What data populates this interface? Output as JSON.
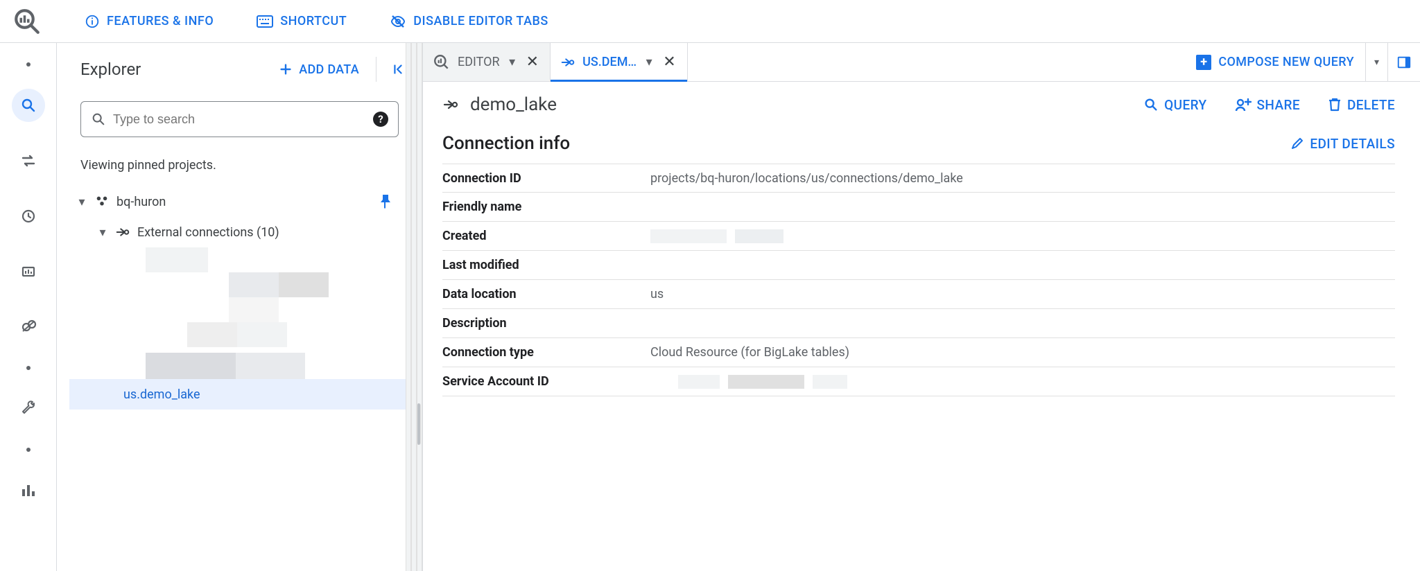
{
  "topbar": {
    "features_info": "FEATURES & INFO",
    "shortcut": "SHORTCUT",
    "disable_tabs": "DISABLE EDITOR TABS"
  },
  "explorer": {
    "title": "Explorer",
    "add_data": "ADD DATA",
    "search_placeholder": "Type to search",
    "pinned_msg": "Viewing pinned projects.",
    "project_name": "bq-huron",
    "external_connections": "External connections (10)",
    "selected_connection": "us.demo_lake"
  },
  "tabs": {
    "editor": "EDITOR",
    "active": "US.DEM…",
    "compose": "COMPOSE NEW QUERY"
  },
  "detail": {
    "title": "demo_lake",
    "actions": {
      "query": "QUERY",
      "share": "SHARE",
      "delete": "DELETE"
    },
    "section_title": "Connection info",
    "edit": "EDIT DETAILS",
    "rows": {
      "connection_id": {
        "k": "Connection ID",
        "v": "projects/bq-huron/locations/us/connections/demo_lake"
      },
      "friendly_name": {
        "k": "Friendly name",
        "v": ""
      },
      "created": {
        "k": "Created",
        "v": ""
      },
      "last_modified": {
        "k": "Last modified",
        "v": ""
      },
      "data_location": {
        "k": "Data location",
        "v": "us"
      },
      "description": {
        "k": "Description",
        "v": ""
      },
      "connection_type": {
        "k": "Connection type",
        "v": "Cloud Resource (for BigLake tables)"
      },
      "service_account_id": {
        "k": "Service Account ID",
        "v": ""
      }
    }
  }
}
